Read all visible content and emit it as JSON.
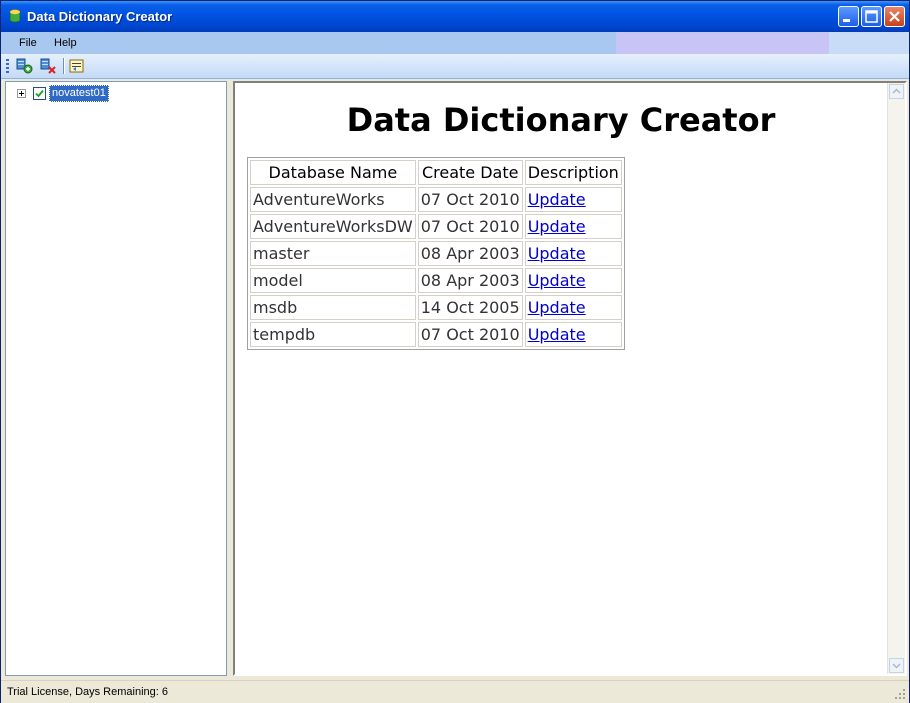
{
  "window": {
    "title": "Data Dictionary Creator",
    "controls": [
      "minimize",
      "maximize",
      "close"
    ]
  },
  "menu": {
    "items": [
      {
        "label": "File"
      },
      {
        "label": "Help"
      }
    ]
  },
  "toolbar": {
    "buttons": [
      {
        "icon": "connect-server-icon"
      },
      {
        "icon": "disconnect-server-icon"
      },
      {
        "icon": "export-icon"
      }
    ]
  },
  "tree": {
    "nodes": [
      {
        "label": "novatest01",
        "checked": true,
        "expanded": false,
        "selected": true
      }
    ]
  },
  "content": {
    "heading": "Data Dictionary Creator",
    "table": {
      "columns": [
        "Database Name",
        "Create Date",
        "Description"
      ],
      "rows": [
        {
          "name": "AdventureWorks",
          "date": "07 Oct 2010",
          "action": "Update"
        },
        {
          "name": "AdventureWorksDW",
          "date": "07 Oct 2010",
          "action": "Update"
        },
        {
          "name": "master",
          "date": "08 Apr 2003",
          "action": "Update"
        },
        {
          "name": "model",
          "date": "08 Apr 2003",
          "action": "Update"
        },
        {
          "name": "msdb",
          "date": "14 Oct 2005",
          "action": "Update"
        },
        {
          "name": "tempdb",
          "date": "07 Oct 2010",
          "action": "Update"
        }
      ]
    }
  },
  "status": {
    "text": "Trial License, Days Remaining: 6"
  },
  "colors": {
    "title_bar": "#0054e3",
    "menu_bar": "#a8c8f0",
    "selection": "#316ac5",
    "link": "#0000cc"
  }
}
